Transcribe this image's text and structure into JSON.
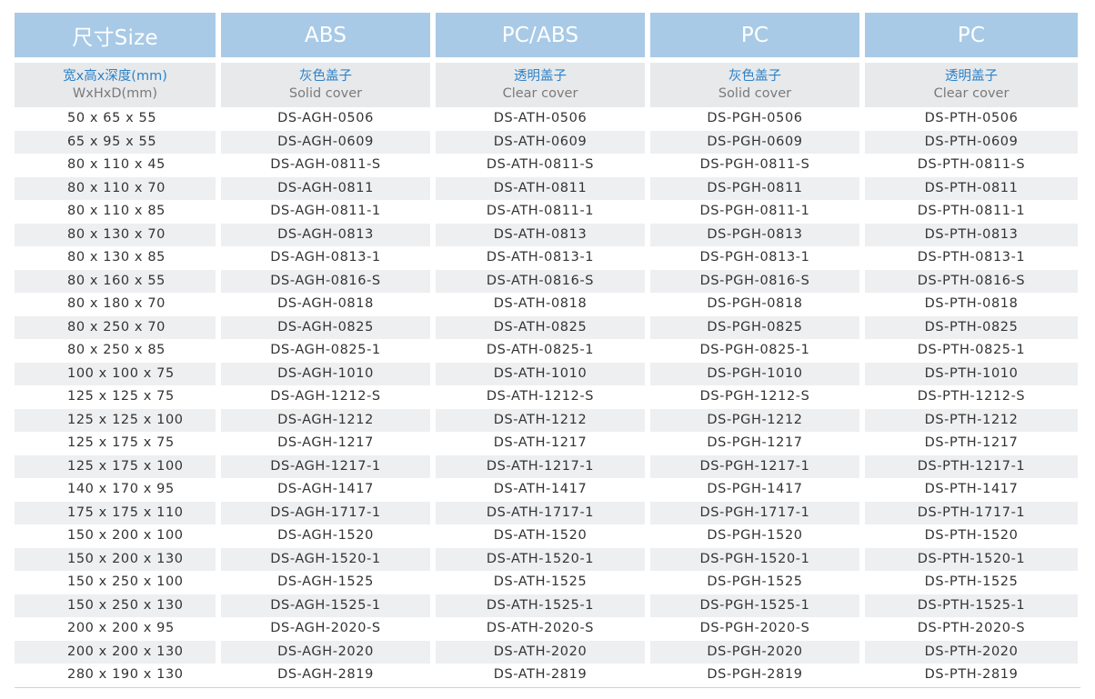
{
  "headers": [
    "尺寸Size",
    "ABS",
    "PC/ABS",
    "PC",
    "PC"
  ],
  "subheaders": [
    {
      "cn": "宽x高x深度(mm)",
      "en": "WxHxD(mm)"
    },
    {
      "cn": "灰色盖子",
      "en": "Solid cover"
    },
    {
      "cn": "透明盖子",
      "en": "Clear cover"
    },
    {
      "cn": "灰色盖子",
      "en": "Solid cover"
    },
    {
      "cn": "透明盖子",
      "en": "Clear cover"
    }
  ],
  "rows": [
    [
      "50 x 65 x 55",
      "DS-AGH-0506",
      "DS-ATH-0506",
      "DS-PGH-0506",
      "DS-PTH-0506"
    ],
    [
      "65 x 95 x 55",
      "DS-AGH-0609",
      "DS-ATH-0609",
      "DS-PGH-0609",
      "DS-PTH-0609"
    ],
    [
      "80 x 110 x 45",
      "DS-AGH-0811-S",
      "DS-ATH-0811-S",
      "DS-PGH-0811-S",
      "DS-PTH-0811-S"
    ],
    [
      "80 x 110 x 70",
      "DS-AGH-0811",
      "DS-ATH-0811",
      "DS-PGH-0811",
      "DS-PTH-0811"
    ],
    [
      "80 x 110 x 85",
      "DS-AGH-0811-1",
      "DS-ATH-0811-1",
      "DS-PGH-0811-1",
      "DS-PTH-0811-1"
    ],
    [
      "80 x 130 x 70",
      "DS-AGH-0813",
      "DS-ATH-0813",
      "DS-PGH-0813",
      "DS-PTH-0813"
    ],
    [
      "80 x 130 x 85",
      "DS-AGH-0813-1",
      "DS-ATH-0813-1",
      "DS-PGH-0813-1",
      "DS-PTH-0813-1"
    ],
    [
      "80 x 160 x 55",
      "DS-AGH-0816-S",
      "DS-ATH-0816-S",
      "DS-PGH-0816-S",
      "DS-PTH-0816-S"
    ],
    [
      "80 x 180 x 70",
      "DS-AGH-0818",
      "DS-ATH-0818",
      "DS-PGH-0818",
      "DS-PTH-0818"
    ],
    [
      "80 x 250 x 70",
      "DS-AGH-0825",
      "DS-ATH-0825",
      "DS-PGH-0825",
      "DS-PTH-0825"
    ],
    [
      "80 x 250 x 85",
      "DS-AGH-0825-1",
      "DS-ATH-0825-1",
      "DS-PGH-0825-1",
      "DS-PTH-0825-1"
    ],
    [
      "100 x 100 x 75",
      "DS-AGH-1010",
      "DS-ATH-1010",
      "DS-PGH-1010",
      "DS-PTH-1010"
    ],
    [
      "125 x 125 x 75",
      "DS-AGH-1212-S",
      "DS-ATH-1212-S",
      "DS-PGH-1212-S",
      "DS-PTH-1212-S"
    ],
    [
      "125 x 125 x 100",
      "DS-AGH-1212",
      "DS-ATH-1212",
      "DS-PGH-1212",
      "DS-PTH-1212"
    ],
    [
      "125 x 175 x 75",
      "DS-AGH-1217",
      "DS-ATH-1217",
      "DS-PGH-1217",
      "DS-PTH-1217"
    ],
    [
      "125 x 175 x 100",
      "DS-AGH-1217-1",
      "DS-ATH-1217-1",
      "DS-PGH-1217-1",
      "DS-PTH-1217-1"
    ],
    [
      "140 x 170 x 95",
      "DS-AGH-1417",
      "DS-ATH-1417",
      "DS-PGH-1417",
      "DS-PTH-1417"
    ],
    [
      "175 x 175 x 110",
      "DS-AGH-1717-1",
      "DS-ATH-1717-1",
      "DS-PGH-1717-1",
      "DS-PTH-1717-1"
    ],
    [
      "150 x 200 x 100",
      "DS-AGH-1520",
      "DS-ATH-1520",
      "DS-PGH-1520",
      "DS-PTH-1520"
    ],
    [
      "150 x 200 x 130",
      "DS-AGH-1520-1",
      "DS-ATH-1520-1",
      "DS-PGH-1520-1",
      "DS-PTH-1520-1"
    ],
    [
      "150 x 250 x 100",
      "DS-AGH-1525",
      "DS-ATH-1525",
      "DS-PGH-1525",
      "DS-PTH-1525"
    ],
    [
      "150 x 250 x 130",
      "DS-AGH-1525-1",
      "DS-ATH-1525-1",
      "DS-PGH-1525-1",
      "DS-PTH-1525-1"
    ],
    [
      "200 x 200 x 95",
      "DS-AGH-2020-S",
      "DS-ATH-2020-S",
      "DS-PGH-2020-S",
      "DS-PTH-2020-S"
    ],
    [
      "200 x 200 x 130",
      "DS-AGH-2020",
      "DS-ATH-2020",
      "DS-PGH-2020",
      "DS-PTH-2020"
    ],
    [
      "280 x 190 x 130",
      "DS-AGH-2819",
      "DS-ATH-2819",
      "DS-PGH-2819",
      "DS-PTH-2819"
    ]
  ],
  "colors": {
    "header_bg": "#a8cae6",
    "subheader_bg": "#e8e9eb",
    "subheader_cn": "#2c82c9",
    "subheader_en": "#7a7a7a",
    "row_alt": "#eeeff1",
    "text": "#333333"
  }
}
